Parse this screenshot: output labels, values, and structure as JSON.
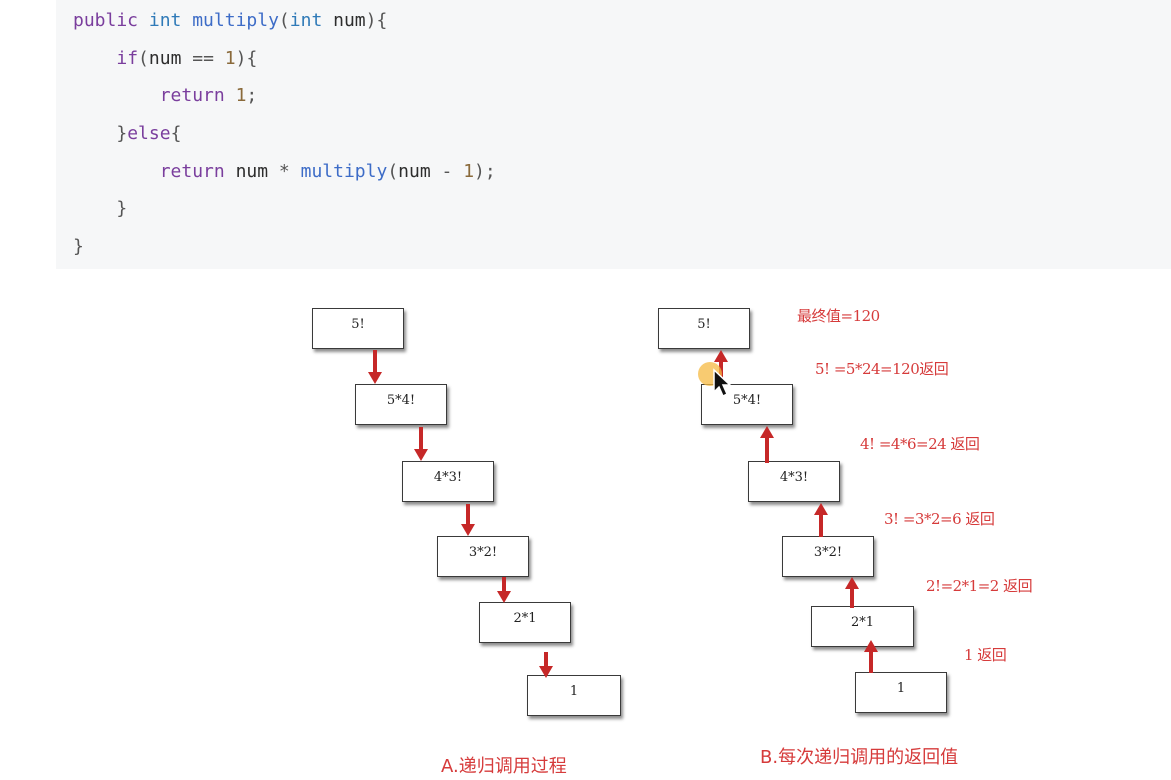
{
  "code": {
    "lines": [
      [
        {
          "t": "public ",
          "c": "kw"
        },
        {
          "t": "int ",
          "c": "ty"
        },
        {
          "t": "multiply",
          "c": "fn"
        },
        {
          "t": "(",
          "c": "punc"
        },
        {
          "t": "int ",
          "c": "ty"
        },
        {
          "t": "num",
          "c": "plain"
        },
        {
          "t": "){",
          "c": "punc"
        }
      ],
      [
        {
          "t": "    ",
          "c": "plain"
        },
        {
          "t": "if",
          "c": "kw"
        },
        {
          "t": "(",
          "c": "punc"
        },
        {
          "t": "num ",
          "c": "plain"
        },
        {
          "t": "== ",
          "c": "punc"
        },
        {
          "t": "1",
          "c": "num"
        },
        {
          "t": "){",
          "c": "punc"
        }
      ],
      [
        {
          "t": "        ",
          "c": "plain"
        },
        {
          "t": "return ",
          "c": "kw"
        },
        {
          "t": "1",
          "c": "num"
        },
        {
          "t": ";",
          "c": "punc"
        }
      ],
      [
        {
          "t": "    ",
          "c": "plain"
        },
        {
          "t": "}",
          "c": "punc"
        },
        {
          "t": "else",
          "c": "kw"
        },
        {
          "t": "{",
          "c": "punc"
        }
      ],
      [
        {
          "t": "        ",
          "c": "plain"
        },
        {
          "t": "return ",
          "c": "kw"
        },
        {
          "t": "num ",
          "c": "plain"
        },
        {
          "t": "* ",
          "c": "punc"
        },
        {
          "t": "multiply",
          "c": "fn"
        },
        {
          "t": "(",
          "c": "punc"
        },
        {
          "t": "num ",
          "c": "plain"
        },
        {
          "t": "- ",
          "c": "punc"
        },
        {
          "t": "1",
          "c": "num"
        },
        {
          "t": ");",
          "c": "punc"
        }
      ],
      [
        {
          "t": "    ",
          "c": "plain"
        },
        {
          "t": "}",
          "c": "punc"
        }
      ],
      [
        {
          "t": "}",
          "c": "punc"
        }
      ]
    ]
  },
  "diagram_a": {
    "nodes": [
      "5!",
      "5*4!",
      "4*3!",
      "3*2!",
      "2*1",
      "1"
    ],
    "caption": "A.递归调用过程"
  },
  "diagram_b": {
    "nodes": [
      "5!",
      "5*4!",
      "4*3!",
      "3*2!",
      "2*1",
      "1"
    ],
    "notes": [
      "最终值=120",
      "5! =5*24=120返回",
      "4! =4*6=24 返回",
      "3! =3*2=6 返回",
      "2!=2*1=2 返回",
      "1 返回"
    ],
    "caption": "B.每次递归调用的返回值"
  },
  "colors": {
    "arrow": "#c62828",
    "annotation": "#d63b3b",
    "code_bg": "#f6f7f8"
  }
}
